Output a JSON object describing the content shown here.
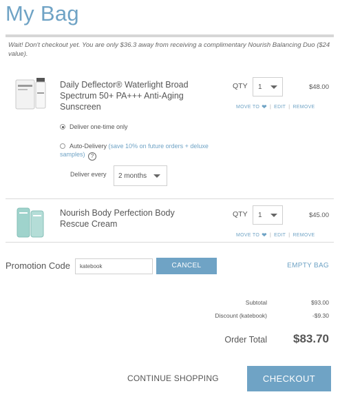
{
  "page": {
    "title": "My Bag",
    "promo_message": "Wait! Don't checkout yet. You are only $36.3 away from receiving a complimentary Nourish Balancing Duo ($24 value)."
  },
  "items": [
    {
      "name": "Daily Deflector® Waterlight Broad Spectrum 50+ PA+++ Anti-Aging Sunscreen",
      "qty_label": "QTY",
      "qty": "1",
      "price": "$48.00",
      "move_to": "MOVE TO",
      "edit": "EDIT",
      "remove": "REMOVE",
      "delivery": {
        "one_time": "Deliver one-time only",
        "auto": "Auto-Delivery",
        "auto_note": "(save 10% on future orders + deluxe samples)",
        "help": "?",
        "every_label": "Deliver every",
        "frequency": "2 months",
        "selected": "one_time"
      }
    },
    {
      "name": "Nourish Body Perfection Body Rescue Cream",
      "qty_label": "QTY",
      "qty": "1",
      "price": "$45.00",
      "move_to": "MOVE TO",
      "edit": "EDIT",
      "remove": "REMOVE"
    }
  ],
  "promotion": {
    "label": "Promotion Code",
    "value": "katebook",
    "cancel": "CANCEL",
    "empty_bag": "EMPTY BAG"
  },
  "summary": {
    "subtotal_label": "Subtotal",
    "subtotal": "$93.00",
    "discount_label": "Discount (katebook)",
    "discount": "-$9.30",
    "total_label": "Order Total",
    "total": "$83.70"
  },
  "footer": {
    "continue": "CONTINUE SHOPPING",
    "checkout": "CHECKOUT"
  },
  "colors": {
    "accent": "#6fa3c5",
    "rule": "#d6d6d6",
    "text": "#555555"
  },
  "icons": {
    "heart": "heart-icon",
    "select_caret": "chevron-down-icon",
    "help": "help-icon"
  }
}
